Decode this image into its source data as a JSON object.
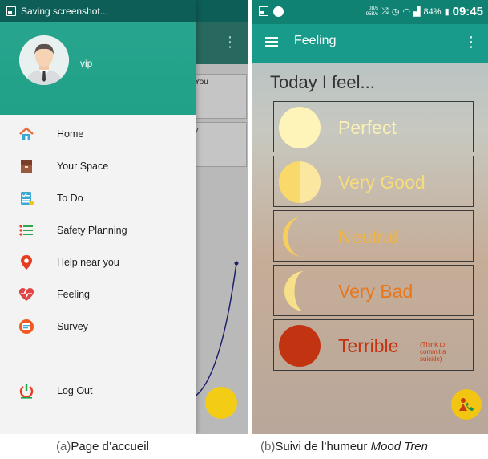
{
  "screen_a": {
    "status_text": "Saving screenshot...",
    "username": "vip",
    "background_cards": [
      "r You",
      "ey"
    ],
    "menu": [
      {
        "label": "Home",
        "icon": "home-icon",
        "color": "#e9693a"
      },
      {
        "label": "Your Space",
        "icon": "box-icon",
        "color": "#8b4b34"
      },
      {
        "label": "To Do",
        "icon": "checklist-icon",
        "color": "#3aa8d1"
      },
      {
        "label": "Safety Planning",
        "icon": "list-icon",
        "color": "#2fa64a"
      },
      {
        "label": "Help near you",
        "icon": "location-pin-icon",
        "color": "#e63c20"
      },
      {
        "label": "Feeling",
        "icon": "heart-pulse-icon",
        "color": "#e04444"
      },
      {
        "label": "Survey",
        "icon": "survey-icon",
        "color": "#f05a22"
      },
      {
        "label": "Log Out",
        "icon": "power-icon",
        "color": "#1aa64f"
      }
    ],
    "caption_letter": "(a)",
    "caption_text": "Page d’accueil"
  },
  "screen_b": {
    "status": {
      "speed_up": "0B/s",
      "speed_down": "95B/s",
      "battery": "84%",
      "time": "09:45"
    },
    "toolbar_title": "Feeling",
    "heading": "Today I feel...",
    "moods": [
      {
        "label": "Perfect",
        "color": "#fef3b8",
        "icon": "full-moon-icon"
      },
      {
        "label": "Very Good",
        "color": "#fbe48a",
        "icon": "half-moon-icon"
      },
      {
        "label": "Neutral",
        "color": "#f4be4b",
        "icon": "crescent-moon-icon"
      },
      {
        "label": "Very Bad",
        "color": "#ea7b1c",
        "icon": "thin-crescent-icon"
      },
      {
        "label": "Terrible",
        "color": "#c23411",
        "icon": "red-circle-icon",
        "note": "(Think to commit a suicide)"
      }
    ],
    "caption_letter": "(b)",
    "caption_text": "Suivi de l’humeur",
    "caption_italic": "Mood Tren"
  }
}
